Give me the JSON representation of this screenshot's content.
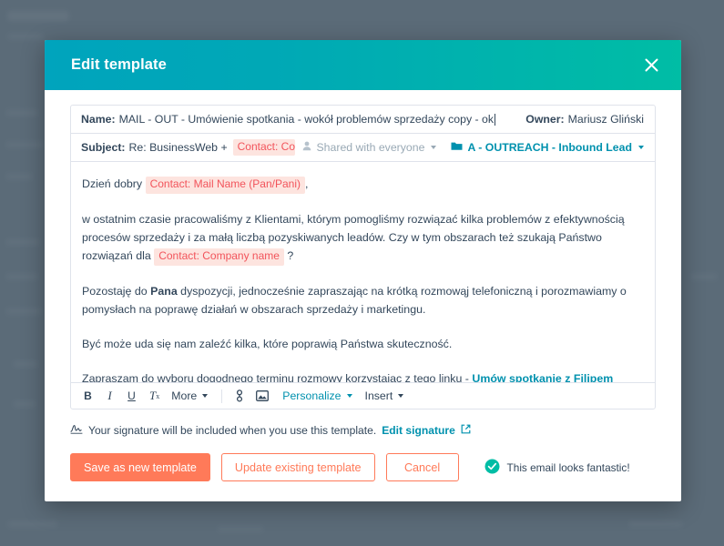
{
  "modal": {
    "title": "Edit template",
    "close_icon": "close-icon"
  },
  "fields": {
    "name_label": "Name:",
    "name_value": "MAIL - OUT - Umówienie spotkania - wokół problemów sprzedaży copy - ok",
    "owner_label": "Owner:",
    "owner_value": "Mariusz Gliński",
    "subject_label": "Subject:",
    "subject_value": "Re: BusinessWeb +",
    "subject_token": "Contact: Company name",
    "sharing": "Shared with everyone",
    "folder": "A - OUTREACH - Inbound Lead"
  },
  "mail": {
    "greeting_text": "Dzień dobry",
    "greeting_token": "Contact: Mail Name (Pan/Pani)",
    "greeting_comma": ",",
    "p1_a": "w ostatnim czasie pracowaliśmy z Klientami, którym pomogliśmy rozwiązać kilka problemów z efektywnością procesów sprzedaży i za małą liczbą pozyskiwanych leadów. Czy w tym obszarach też szukają Państwo rozwiązań dla",
    "p1_token": "Contact: Company name",
    "p1_b": "?",
    "p2_a": "Pozostaję do",
    "p2_bold": "Pana",
    "p2_b": "dyspozycji, jednocześnie zapraszając na krótką rozmowąj telefoniczną i porozmawiamy o pomysłach na poprawę działań w obszarach sprzedaży i marketingu.",
    "p3": "Być może uda się nam zaleźć kilka, które poprawią Państwa skuteczność.",
    "p4_a": "Zapraszam do wyboru dogodnego terminu rozmowy korzystając z tego linku -",
    "p4_link": "Umów spotkanie z Filipem Kulikowskim"
  },
  "toolbar": {
    "bold": "B",
    "italic": "I",
    "underline": "U",
    "clear_format": "T",
    "clear_format_sub": "x",
    "more": "More",
    "personalize": "Personalize",
    "insert": "Insert"
  },
  "signature": {
    "text": "Your signature will be included when you use this template.",
    "link": "Edit signature"
  },
  "footer": {
    "save": "Save as new template",
    "update": "Update existing template",
    "cancel": "Cancel",
    "status": "This email looks fantastic!"
  },
  "colors": {
    "header_gradient_start": "#00a4bd",
    "header_gradient_end": "#00bda5",
    "accent_orange": "#ff7a59",
    "link_teal": "#0091ae",
    "token_bg": "#fde4df",
    "token_text": "#f2545b",
    "text_primary": "#33475b",
    "overlay": "#5b6b78",
    "success_green": "#00bda5"
  }
}
